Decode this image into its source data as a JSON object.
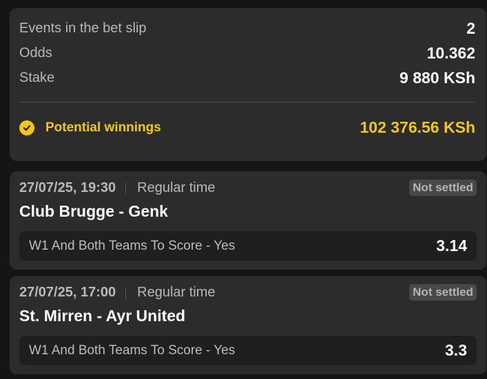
{
  "summary": {
    "events_label": "Events in the bet slip",
    "events_value": "2",
    "odds_label": "Odds",
    "odds_value": "10.362",
    "stake_label": "Stake",
    "stake_value": "9 880 KSh",
    "winnings_label": "Potential winnings",
    "winnings_value": "102 376.56 KSh",
    "winnings_icon": "check-circle-icon",
    "accent_color": "#f5c518"
  },
  "events": [
    {
      "date": "27/07/25, 19:30",
      "period": "Regular time",
      "status": "Not settled",
      "match": "Club Brugge - Genk",
      "pick": "W1 And Both Teams To Score - Yes",
      "odds": "3.14"
    },
    {
      "date": "27/07/25, 17:00",
      "period": "Regular time",
      "status": "Not settled",
      "match": "St. Mirren - Ayr United",
      "pick": "W1 And Both Teams To Score - Yes",
      "odds": "3.3"
    }
  ]
}
